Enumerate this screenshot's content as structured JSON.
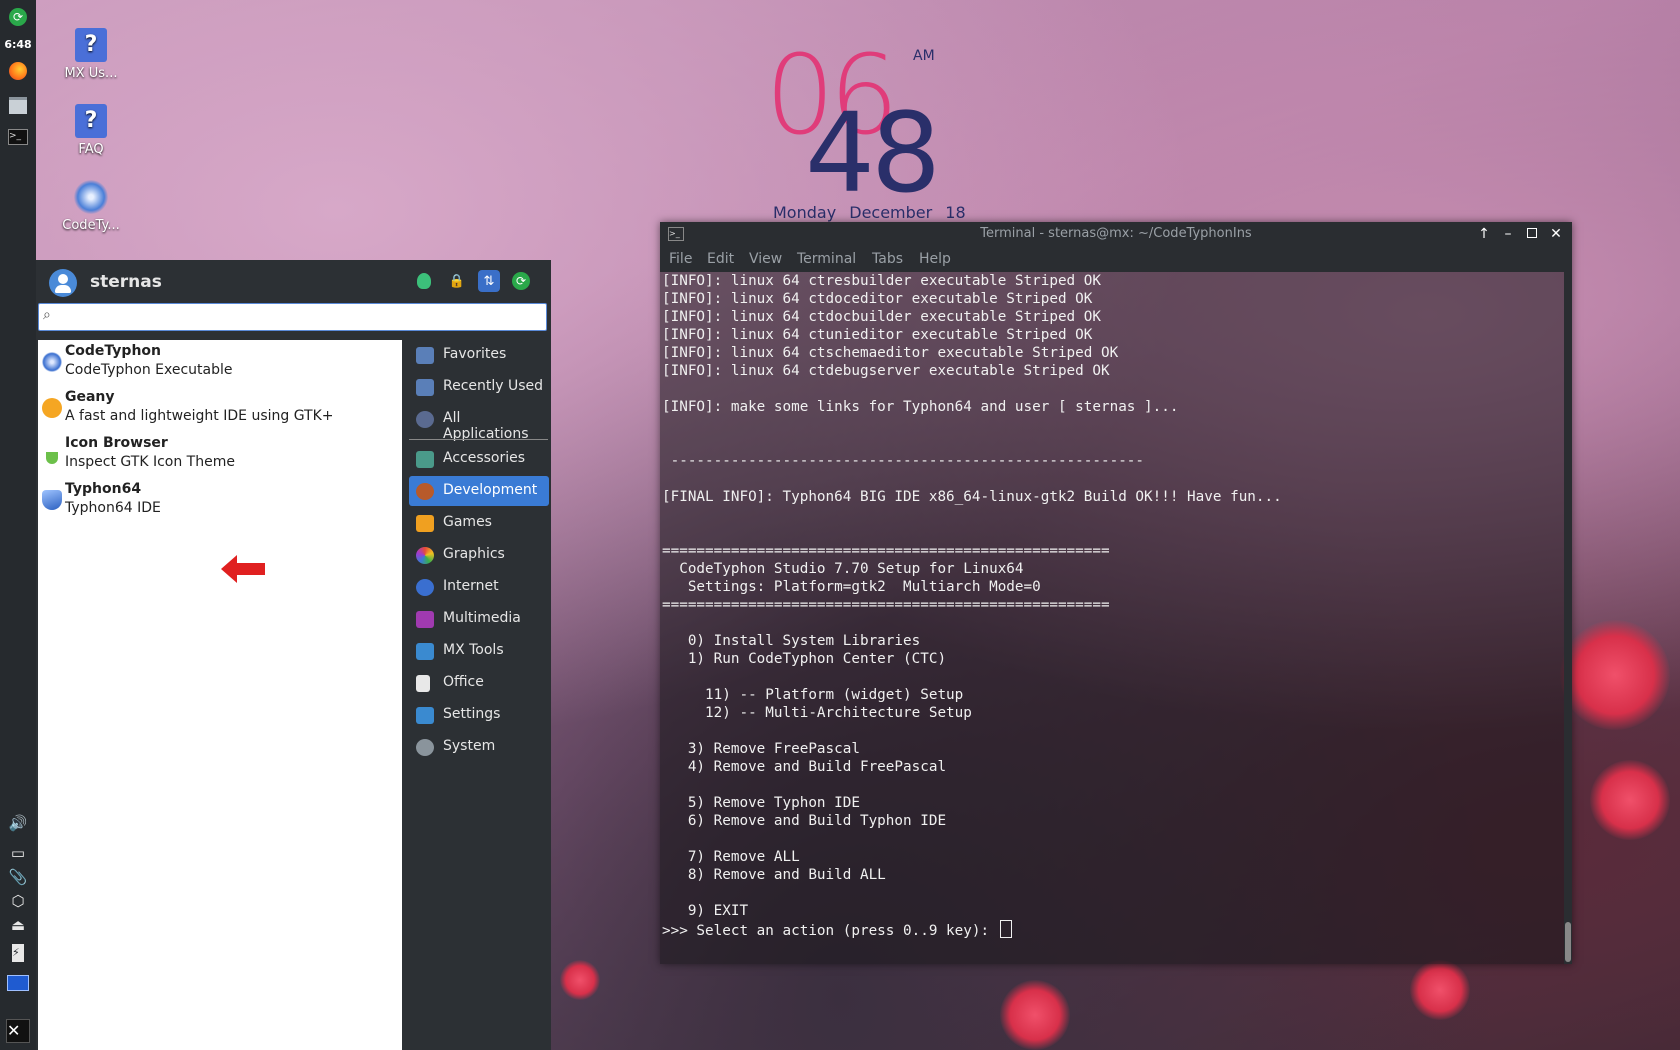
{
  "panel": {
    "clock": "6:48"
  },
  "desktop": {
    "icons": [
      {
        "label": "MX Us..."
      },
      {
        "label": "FAQ"
      },
      {
        "label": "CodeTy..."
      }
    ]
  },
  "conky": {
    "hour": "06",
    "minute": "48",
    "ampm": "AM",
    "date": "Monday December 18"
  },
  "menu": {
    "username": "sternas",
    "search": {
      "value": "",
      "placeholder": ""
    },
    "apps": [
      {
        "name": "CodeTyphon",
        "desc": "CodeTyphon Executable"
      },
      {
        "name": "Geany",
        "desc": "A fast and lightweight IDE using GTK+"
      },
      {
        "name": "Icon Browser",
        "desc": "Inspect GTK Icon Theme"
      },
      {
        "name": "Typhon64",
        "desc": "Typhon64 IDE"
      }
    ],
    "categories": [
      {
        "label": "Favorites"
      },
      {
        "label": "Recently Used"
      },
      {
        "label": "All Applications"
      },
      {
        "label": "Accessories"
      },
      {
        "label": "Development"
      },
      {
        "label": "Games"
      },
      {
        "label": "Graphics"
      },
      {
        "label": "Internet"
      },
      {
        "label": "Multimedia"
      },
      {
        "label": "MX Tools"
      },
      {
        "label": "Office"
      },
      {
        "label": "Settings"
      },
      {
        "label": "System"
      }
    ],
    "selected_category": "Development",
    "accent": "#3a7bd5"
  },
  "terminal": {
    "title": "Terminal - sternas@mx: ~/CodeTyphonIns",
    "menu": [
      "File",
      "Edit",
      "View",
      "Terminal",
      "Tabs",
      "Help"
    ],
    "output": "[INFO]: linux 64 ctresbuilder executable Striped OK\n[INFO]: linux 64 ctdoceditor executable Striped OK\n[INFO]: linux 64 ctdocbuilder executable Striped OK\n[INFO]: linux 64 ctunieditor executable Striped OK\n[INFO]: linux 64 ctschemaeditor executable Striped OK\n[INFO]: linux 64 ctdebugserver executable Striped OK\n\n[INFO]: make some links for Typhon64 and user [ sternas ]...\n\n\n -------------------------------------------------------\n\n[FINAL INFO]: Typhon64 BIG IDE x86_64-linux-gtk2 Build OK!!! Have fun...\n\n\n====================================================\n  CodeTyphon Studio 7.70 Setup for Linux64\n   Settings: Platform=gtk2  Multiarch Mode=0\n====================================================\n\n   0) Install System Libraries\n   1) Run CodeTyphon Center (CTC)\n\n     11) -- Platform (widget) Setup\n     12) -- Multi-Architecture Setup\n\n   3) Remove FreePascal\n   4) Remove and Build FreePascal\n\n   5) Remove Typhon IDE\n   6) Remove and Build Typhon IDE\n\n   7) Remove ALL\n   8) Remove and Build ALL\n\n   9) EXIT\n",
    "prompt": ">>> Select an action (press 0..9 key): "
  }
}
